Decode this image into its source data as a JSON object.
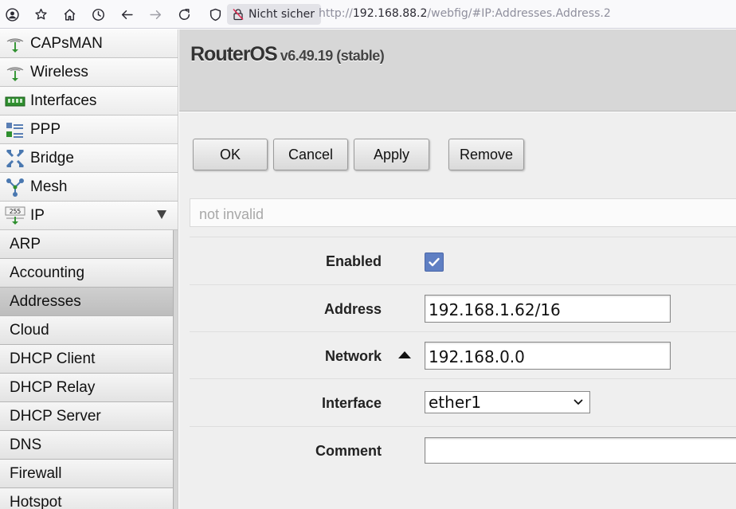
{
  "browser": {
    "security_label": "Nicht sicher",
    "url_prefix": "http://",
    "url_host": "192.168.88.2",
    "url_path": "/webfig/#IP:Addresses.Address.2"
  },
  "sidebar": {
    "items": [
      {
        "label": "CAPsMAN",
        "icon": "capsman-icon"
      },
      {
        "label": "Wireless",
        "icon": "wireless-icon"
      },
      {
        "label": "Interfaces",
        "icon": "interfaces-icon"
      },
      {
        "label": "PPP",
        "icon": "ppp-icon"
      },
      {
        "label": "Bridge",
        "icon": "bridge-icon"
      },
      {
        "label": "Mesh",
        "icon": "mesh-icon"
      },
      {
        "label": "IP",
        "icon": "ip-icon"
      }
    ],
    "ip_submenu": [
      "ARP",
      "Accounting",
      "Addresses",
      "Cloud",
      "DHCP Client",
      "DHCP Relay",
      "DHCP Server",
      "DNS",
      "Firewall",
      "Hotspot"
    ],
    "active_submenu": "Addresses"
  },
  "header": {
    "brand": "RouterOS",
    "version": "v6.49.19 (stable)"
  },
  "toolbar": {
    "ok_label": "OK",
    "cancel_label": "Cancel",
    "apply_label": "Apply",
    "remove_label": "Remove"
  },
  "status": {
    "text": "not invalid"
  },
  "form": {
    "enabled_label": "Enabled",
    "enabled_value": true,
    "address_label": "Address",
    "address_value": "192.168.1.62/16",
    "network_label": "Network",
    "network_value": "192.168.0.0",
    "interface_label": "Interface",
    "interface_value": "ether1",
    "comment_label": "Comment",
    "comment_value": ""
  },
  "colors": {
    "checkbox_accent": "#5f7fc3",
    "header_bg": "#d7d7d7",
    "content_bg": "#efefef"
  }
}
